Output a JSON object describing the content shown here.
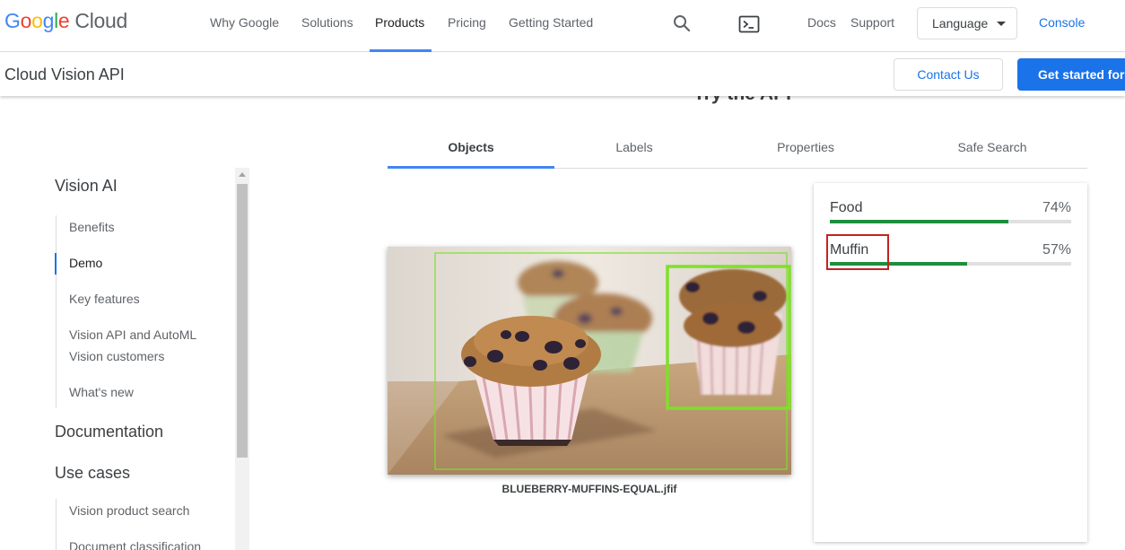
{
  "logo": {
    "g1": "G",
    "o1": "o",
    "o2": "o",
    "g2": "g",
    "l": "l",
    "e": "e",
    "cloud": "Cloud"
  },
  "nav": {
    "items": [
      "Why Google",
      "Solutions",
      "Products",
      "Pricing",
      "Getting Started"
    ],
    "active_item": "Products",
    "search_icon": "search-icon",
    "terminal_icon": "terminal-icon",
    "docs": "Docs",
    "support": "Support",
    "language": "Language",
    "console": "Console"
  },
  "subnav": {
    "product_title": "Cloud Vision API",
    "contact": "Contact Us",
    "get_started": "Get started for free"
  },
  "section_heading": "Try the API",
  "sidenav": {
    "groups": [
      {
        "title": "Vision AI",
        "links": [
          "Benefits",
          "Demo",
          "Key features",
          "Vision API and AutoML Vision customers",
          "What's new"
        ]
      },
      {
        "title": "Documentation",
        "links": []
      },
      {
        "title": "Use cases",
        "links": [
          "Vision product search",
          "Document classification"
        ]
      }
    ],
    "active_link": "Demo"
  },
  "tabs": [
    "Objects",
    "Labels",
    "Properties",
    "Safe Search"
  ],
  "active_tab": "Objects",
  "image": {
    "file_name": "BLUEBERRY-MUFFINS-EQUAL.jfif",
    "box_color": "#7fe02a"
  },
  "results": [
    {
      "label": "Food",
      "percent_text": "74%",
      "value": 0.74
    },
    {
      "label": "Muffin",
      "percent_text": "57%",
      "value": 0.57
    }
  ],
  "colors": {
    "accent": "#1a73e8",
    "bar_fill": "#1e8e3e",
    "highlight": "#c5221f"
  }
}
